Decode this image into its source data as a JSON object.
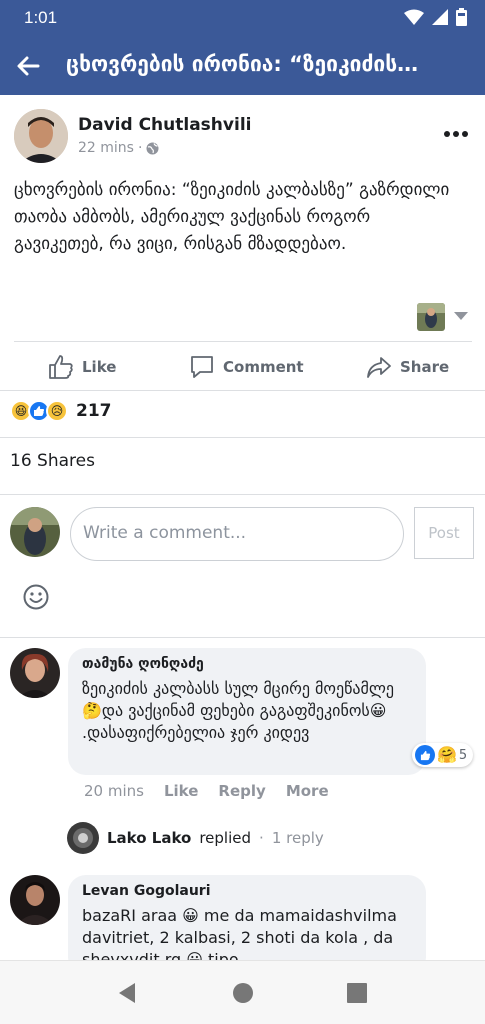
{
  "status": {
    "time": "1:01"
  },
  "appbar": {
    "title": "ცხოვრების ირონია: “ზეიკიძის…"
  },
  "post": {
    "author": "David Chutlashvili",
    "time": "22 mins",
    "text": "ცხოვრების ირონია: “ზეიკიძის კალბასზე” გაზრდილი თაობა ამბობს, ამერიკულ ვაქცინას როგორ გავიკეთებ, რა ვიცი, რისგან მზადდებაო."
  },
  "actions": {
    "like": "Like",
    "comment": "Comment",
    "share": "Share"
  },
  "stats": {
    "reactions_count": "217",
    "shares": "16 Shares"
  },
  "composer": {
    "placeholder": "Write a comment...",
    "post_label": "Post"
  },
  "comments": [
    {
      "name": "თამუნა ღონღაძე",
      "text": "ზეიკიძის კალბასს სულ მცირე მოეწამლე🤔და ვაქცინამ ფეხები გაგაფშეკინოს😀 .დასაფიქრებელია ჯერ კიდევ",
      "time": "20 mins",
      "like": "Like",
      "reply": "Reply",
      "more": "More",
      "reaction_count": "5"
    },
    {
      "name": "Levan Gogolauri",
      "text": "bazaRI araa 😀 me da mamaidashvilma davitriet, 2 kalbasi, 2 shoti da kola , da shevxvdit rg 😀 tipo"
    }
  ],
  "reply_summary": {
    "name": "Lako Lako",
    "action": "replied",
    "count": "1 reply"
  },
  "colors": {
    "brand": "#3b5998",
    "like_blue": "#1877f2"
  }
}
